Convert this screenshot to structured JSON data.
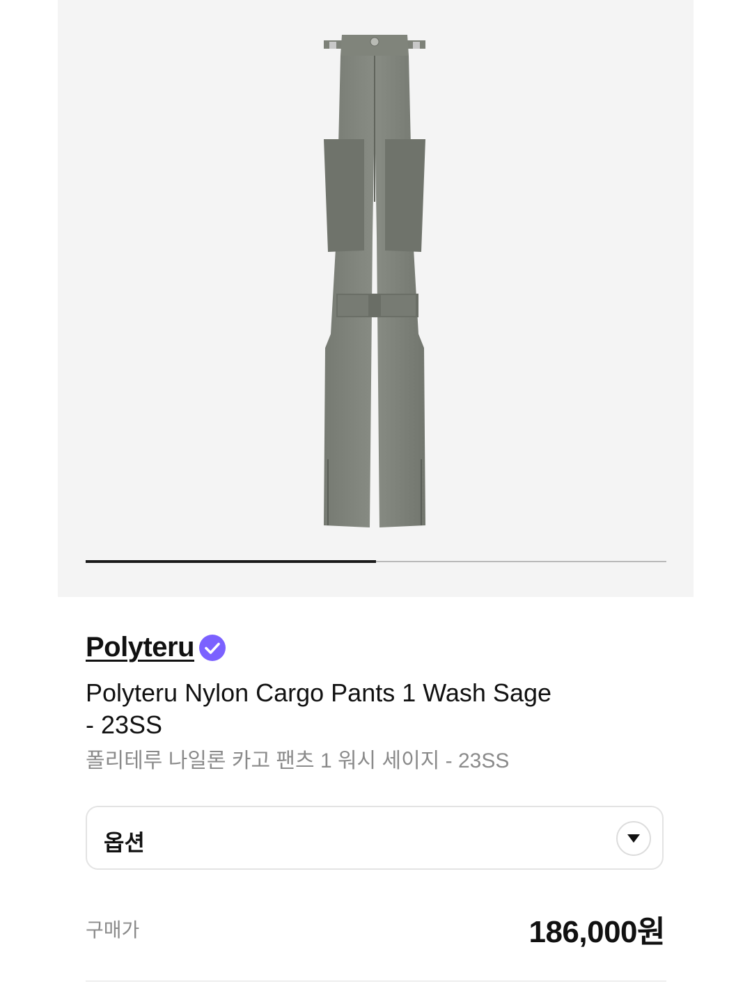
{
  "gallery": {
    "image_alt": "Sage nylon cargo pants",
    "progress": 0.5,
    "colors": {
      "track": "#b9b9b9",
      "fill": "#1a1a1a",
      "background": "#f4f4f4"
    }
  },
  "product": {
    "brand": "Polyteru",
    "verified_icon": "verified-badge-icon",
    "title_line1": "Polyteru Nylon Cargo Pants 1 Wash Sage",
    "title_line2": "- 23SS",
    "subtitle": "폴리테루 나일론 카고 팬츠 1 워시 세이지 - 23SS",
    "accent_color": "#7b61ff"
  },
  "options": {
    "label": "옵션",
    "icon": "chevron-down-icon"
  },
  "purchase": {
    "label": "구매가",
    "price": "186,000원"
  }
}
